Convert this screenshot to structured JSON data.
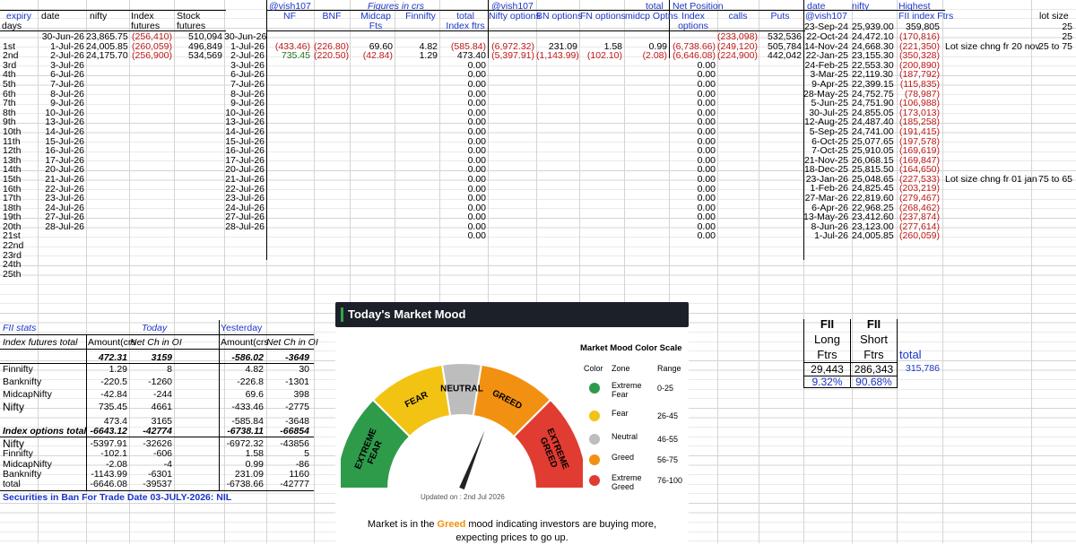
{
  "header": {
    "expiry": "expiry",
    "date": "date",
    "nifty": "nifty",
    "index": "Index",
    "futures": "futures",
    "stock": "Stock",
    "stock_futures": "futures",
    "days": "days",
    "vish1": "@vish107",
    "figures": "Figures in crs",
    "vish2": "@vish107",
    "total": "total",
    "net_position": "Net Position",
    "nf": "NF",
    "bnf": "BNF",
    "midcap": "Midcap",
    "fts": "Fts",
    "finnifty": "Finnifty",
    "total2": "total",
    "index_ftrs": "Index ftrs",
    "nifty_options": "Nifty options",
    "bn_options": "BN options",
    "fn_options": "FN options",
    "midcp_optns": "midcp Optns",
    "index_options_a": "Index",
    "index_options_b": "options",
    "calls": "calls",
    "puts": "Puts",
    "r_date": "date",
    "r_nifty": "nifty",
    "r_highest": "Highest",
    "r_vish": "@vish107",
    "r_fii": "FII index Ftrs",
    "lot_size": "lot size"
  },
  "rows": [
    {
      "day": "",
      "date": "30-Jun-26",
      "nifty": "23,865.75",
      "index": "(256,410)",
      "stock": "510,094",
      "d2": "30-Jun-26"
    },
    {
      "day": "1st",
      "date": "1-Jul-26",
      "nifty": "24,005.85",
      "index": "(260,059)",
      "stock": "496,849",
      "d2": "1-Jul-26"
    },
    {
      "day": "2nd",
      "date": "2-Jul-26",
      "nifty": "24,175.70",
      "index": "(256,900)",
      "stock": "534,569",
      "d2": "2-Jul-26"
    },
    {
      "day": "3rd",
      "date": "3-Jul-26",
      "d2": "3-Jul-26"
    },
    {
      "day": "4th",
      "date": "6-Jul-26",
      "d2": "6-Jul-26"
    },
    {
      "day": "5th",
      "date": "7-Jul-26",
      "d2": "7-Jul-26"
    },
    {
      "day": "6th",
      "date": "8-Jul-26",
      "d2": "8-Jul-26"
    },
    {
      "day": "7th",
      "date": "9-Jul-26",
      "d2": "9-Jul-26"
    },
    {
      "day": "8th",
      "date": "10-Jul-26",
      "d2": "10-Jul-26"
    },
    {
      "day": "9th",
      "date": "13-Jul-26",
      "d2": "13-Jul-26"
    },
    {
      "day": "10th",
      "date": "14-Jul-26",
      "d2": "14-Jul-26"
    },
    {
      "day": "11th",
      "date": "15-Jul-26",
      "d2": "15-Jul-26"
    },
    {
      "day": "12th",
      "date": "16-Jul-26",
      "d2": "16-Jul-26"
    },
    {
      "day": "13th",
      "date": "17-Jul-26",
      "d2": "17-Jul-26"
    },
    {
      "day": "14th",
      "date": "20-Jul-26",
      "d2": "20-Jul-26"
    },
    {
      "day": "15th",
      "date": "21-Jul-26",
      "d2": "21-Jul-26"
    },
    {
      "day": "16th",
      "date": "22-Jul-26",
      "d2": "22-Jul-26"
    },
    {
      "day": "17th",
      "date": "23-Jul-26",
      "d2": "23-Jul-26"
    },
    {
      "day": "18th",
      "date": "24-Jul-26",
      "d2": "24-Jul-26"
    },
    {
      "day": "19th",
      "date": "27-Jul-26",
      "d2": "27-Jul-26"
    },
    {
      "day": "20th",
      "date": "28-Jul-26",
      "d2": "28-Jul-26"
    },
    {
      "day": "21st"
    },
    {
      "day": "22nd"
    },
    {
      "day": "23rd"
    },
    {
      "day": "24th"
    },
    {
      "day": "25th"
    }
  ],
  "figs": {
    "row1": {
      "nf": "(433.46)",
      "bnf": "(226.80)",
      "midcap": "69.60",
      "finnifty": "4.82",
      "total": "(585.84)",
      "nifty_opt": "(6,972.32)",
      "bn_opt": "231.09",
      "fn_opt": "1.58",
      "midcp_opt": "0.99",
      "index_opt": "(6,738.66)",
      "calls": "(233,098)",
      "puts": "532,536"
    },
    "row2": {
      "nf": "735.45",
      "bnf": "(220.50)",
      "midcap": "(42.84)",
      "finnifty": "1.29",
      "total": "473.40",
      "nifty_opt": "(5,397.91)",
      "bn_opt": "(1,143.99)",
      "fn_opt": "(102.10)",
      "midcp_opt": "(2.08)",
      "index_opt": "(6,646.08)",
      "calls": "(249,120)",
      "puts": "505,784"
    },
    "row3_calls": "(224,900)",
    "row3_puts": "442,042",
    "zero": "0.00"
  },
  "right_table": [
    {
      "date": "23-Sep-24",
      "nifty": "25,939.00",
      "high": "359,805",
      "lot": "25"
    },
    {
      "date": "22-Oct-24",
      "nifty": "24,472.10",
      "high": "(170,816)",
      "lot": "25"
    },
    {
      "date": "14-Nov-24",
      "nifty": "24,668.30",
      "high": "(221,350)",
      "note": "Lot size chng fr 20 nov",
      "lot": "25 to 75"
    },
    {
      "date": "22-Jan-25",
      "nifty": "23,155.30",
      "high": "(350,328)"
    },
    {
      "date": "24-Feb-25",
      "nifty": "22,553.30",
      "high": "(200,890)"
    },
    {
      "date": "3-Mar-25",
      "nifty": "22,119.30",
      "high": "(187,792)"
    },
    {
      "date": "9-Apr-25",
      "nifty": "22,399.15",
      "high": "(115,835)"
    },
    {
      "date": "28-May-25",
      "nifty": "24,752.75",
      "high": "(78,987)"
    },
    {
      "date": "5-Jun-25",
      "nifty": "24,751.90",
      "high": "(106,988)"
    },
    {
      "date": "30-Jul-25",
      "nifty": "24,855.05",
      "high": "(173,013)"
    },
    {
      "date": "12-Aug-25",
      "nifty": "24,487.40",
      "high": "(185,258)"
    },
    {
      "date": "5-Sep-25",
      "nifty": "24,741.00",
      "high": "(191,415)"
    },
    {
      "date": "6-Oct-25",
      "nifty": "25,077.65",
      "high": "(197,578)"
    },
    {
      "date": "7-Oct-25",
      "nifty": "25,910.05",
      "high": "(169,619)"
    },
    {
      "date": "21-Nov-25",
      "nifty": "26,068.15",
      "high": "(169,847)"
    },
    {
      "date": "18-Dec-25",
      "nifty": "25,815.50",
      "high": "(164,650)"
    },
    {
      "date": "23-Jan-26",
      "nifty": "25,048.65",
      "high": "(227,533)",
      "note": "Lot size chng fr 01 jan",
      "lot": "75 to 65"
    },
    {
      "date": "1-Feb-26",
      "nifty": "24,825.45",
      "high": "(203,219)"
    },
    {
      "date": "27-Mar-26",
      "nifty": "22,819.60",
      "high": "(279,467)"
    },
    {
      "date": "6-Apr-26",
      "nifty": "22,968.25",
      "high": "(268,462)"
    },
    {
      "date": "13-May-26",
      "nifty": "23,412.60",
      "high": "(237,874)"
    },
    {
      "date": "8-Jun-26",
      "nifty": "23,123.00",
      "high": "(277,614)"
    },
    {
      "date": "1-Jul-26",
      "nifty": "24,005.85",
      "high": "(260,059)"
    }
  ],
  "fii_stats": {
    "title": "FII stats",
    "today": "Today",
    "yesterday": "Yesterday",
    "idx_fut_total": "Index futures total",
    "amount": "Amount(crs",
    "net_ch": "Net Ch in OI",
    "amount2": "Amount(crs",
    "net_ch2": "Net Ch in OI",
    "totals_top": {
      "a": "472.31",
      "b": "3159",
      "c": "-586.02",
      "d": "-3649"
    },
    "futures": [
      {
        "name": "Finnifty",
        "a": "1.29",
        "b": "8",
        "c": "4.82",
        "d": "30"
      },
      {
        "name": "Banknifty",
        "a": "-220.5",
        "b": "-1260",
        "c": "-226.8",
        "d": "-1301"
      },
      {
        "name": "MidcapNifty",
        "a": "-42.84",
        "b": "-244",
        "c": "69.6",
        "d": "398"
      },
      {
        "name": "Nifty",
        "a": "735.45",
        "b": "4661",
        "c": "-433.46",
        "d": "-2775"
      }
    ],
    "fut_sum": {
      "a": "473.4",
      "b": "3165",
      "c": "-585.84",
      "d": "-3648"
    },
    "idx_opt_total": "Index options total",
    "opt_total": {
      "a": "-6643.12",
      "b": "-42774",
      "c": "-6738.11",
      "d": "-66854"
    },
    "options": [
      {
        "name": "Nifty",
        "a": "-5397.91",
        "b": "-32626",
        "c": "-6972.32",
        "d": "-43856"
      },
      {
        "name": "Finnifty",
        "a": "-102.1",
        "b": "-606",
        "c": "1.58",
        "d": "5"
      },
      {
        "name": "MidcapNifty",
        "a": "-2.08",
        "b": "-4",
        "c": "0.99",
        "d": "-86"
      },
      {
        "name": "Banknifty",
        "a": "-1143.99",
        "b": "-6301",
        "c": "231.09",
        "d": "1160"
      },
      {
        "name": "total",
        "a": "-6646.08",
        "b": "-39537",
        "c": "-6738.66",
        "d": "-42777"
      }
    ],
    "ban": "Securities in Ban For Trade Date 03-JULY-2026: NIL"
  },
  "mood": {
    "title": "Today's Market Mood",
    "extreme_fear": "EXTREME FEAR",
    "fear": "FEAR",
    "neutral": "NEUTRAL",
    "greed": "GREED",
    "extreme_greed": "EXTREME GREED",
    "updated": "Updated on : 2nd Jul 2026",
    "msg_a": "Market is in the",
    "msg_word": "Greed",
    "msg_b": "mood indicating investors are buying more,",
    "msg_c": "expecting prices to go up.",
    "needle_value": 62,
    "scale_title": "Market Mood Color Scale",
    "col_color": "Color",
    "col_zone": "Zone",
    "col_range": "Range",
    "legend": [
      {
        "zone": "Extreme Fear",
        "range": "0-25",
        "color": "#2e9b4b"
      },
      {
        "zone": "Fear",
        "range": "26-45",
        "color": "#f2c313"
      },
      {
        "zone": "Neutral",
        "range": "46-55",
        "color": "#bdbdbd"
      },
      {
        "zone": "Greed",
        "range": "56-75",
        "color": "#f29111"
      },
      {
        "zone": "Extreme Greed",
        "range": "76-100",
        "color": "#e03c31"
      }
    ]
  },
  "fii_box": {
    "h1a": "FII",
    "h1b": "FII",
    "h2a": "Long",
    "h2b": "Short",
    "h3a": "Ftrs",
    "h3b": "Ftrs",
    "total": "total",
    "long": "29,443",
    "short": "286,343",
    "total_val": "315,786",
    "long_pct": "9.32%",
    "short_pct": "90.68%"
  }
}
